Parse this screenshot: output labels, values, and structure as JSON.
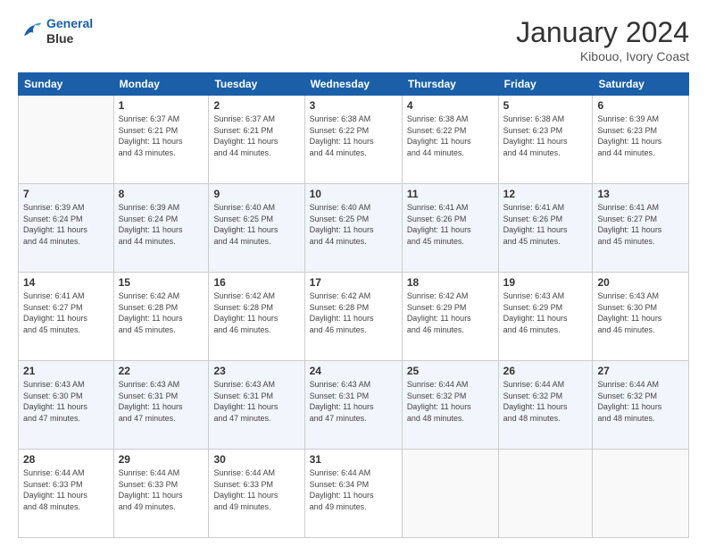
{
  "logo": {
    "line1": "General",
    "line2": "Blue"
  },
  "title": "January 2024",
  "location": "Kibouo, Ivory Coast",
  "days_header": [
    "Sunday",
    "Monday",
    "Tuesday",
    "Wednesday",
    "Thursday",
    "Friday",
    "Saturday"
  ],
  "weeks": [
    [
      {
        "day": "",
        "info": ""
      },
      {
        "day": "1",
        "info": "Sunrise: 6:37 AM\nSunset: 6:21 PM\nDaylight: 11 hours\nand 43 minutes."
      },
      {
        "day": "2",
        "info": "Sunrise: 6:37 AM\nSunset: 6:21 PM\nDaylight: 11 hours\nand 44 minutes."
      },
      {
        "day": "3",
        "info": "Sunrise: 6:38 AM\nSunset: 6:22 PM\nDaylight: 11 hours\nand 44 minutes."
      },
      {
        "day": "4",
        "info": "Sunrise: 6:38 AM\nSunset: 6:22 PM\nDaylight: 11 hours\nand 44 minutes."
      },
      {
        "day": "5",
        "info": "Sunrise: 6:38 AM\nSunset: 6:23 PM\nDaylight: 11 hours\nand 44 minutes."
      },
      {
        "day": "6",
        "info": "Sunrise: 6:39 AM\nSunset: 6:23 PM\nDaylight: 11 hours\nand 44 minutes."
      }
    ],
    [
      {
        "day": "7",
        "info": "Sunrise: 6:39 AM\nSunset: 6:24 PM\nDaylight: 11 hours\nand 44 minutes."
      },
      {
        "day": "8",
        "info": "Sunrise: 6:39 AM\nSunset: 6:24 PM\nDaylight: 11 hours\nand 44 minutes."
      },
      {
        "day": "9",
        "info": "Sunrise: 6:40 AM\nSunset: 6:25 PM\nDaylight: 11 hours\nand 44 minutes."
      },
      {
        "day": "10",
        "info": "Sunrise: 6:40 AM\nSunset: 6:25 PM\nDaylight: 11 hours\nand 44 minutes."
      },
      {
        "day": "11",
        "info": "Sunrise: 6:41 AM\nSunset: 6:26 PM\nDaylight: 11 hours\nand 45 minutes."
      },
      {
        "day": "12",
        "info": "Sunrise: 6:41 AM\nSunset: 6:26 PM\nDaylight: 11 hours\nand 45 minutes."
      },
      {
        "day": "13",
        "info": "Sunrise: 6:41 AM\nSunset: 6:27 PM\nDaylight: 11 hours\nand 45 minutes."
      }
    ],
    [
      {
        "day": "14",
        "info": "Sunrise: 6:41 AM\nSunset: 6:27 PM\nDaylight: 11 hours\nand 45 minutes."
      },
      {
        "day": "15",
        "info": "Sunrise: 6:42 AM\nSunset: 6:28 PM\nDaylight: 11 hours\nand 45 minutes."
      },
      {
        "day": "16",
        "info": "Sunrise: 6:42 AM\nSunset: 6:28 PM\nDaylight: 11 hours\nand 46 minutes."
      },
      {
        "day": "17",
        "info": "Sunrise: 6:42 AM\nSunset: 6:28 PM\nDaylight: 11 hours\nand 46 minutes."
      },
      {
        "day": "18",
        "info": "Sunrise: 6:42 AM\nSunset: 6:29 PM\nDaylight: 11 hours\nand 46 minutes."
      },
      {
        "day": "19",
        "info": "Sunrise: 6:43 AM\nSunset: 6:29 PM\nDaylight: 11 hours\nand 46 minutes."
      },
      {
        "day": "20",
        "info": "Sunrise: 6:43 AM\nSunset: 6:30 PM\nDaylight: 11 hours\nand 46 minutes."
      }
    ],
    [
      {
        "day": "21",
        "info": "Sunrise: 6:43 AM\nSunset: 6:30 PM\nDaylight: 11 hours\nand 47 minutes."
      },
      {
        "day": "22",
        "info": "Sunrise: 6:43 AM\nSunset: 6:31 PM\nDaylight: 11 hours\nand 47 minutes."
      },
      {
        "day": "23",
        "info": "Sunrise: 6:43 AM\nSunset: 6:31 PM\nDaylight: 11 hours\nand 47 minutes."
      },
      {
        "day": "24",
        "info": "Sunrise: 6:43 AM\nSunset: 6:31 PM\nDaylight: 11 hours\nand 47 minutes."
      },
      {
        "day": "25",
        "info": "Sunrise: 6:44 AM\nSunset: 6:32 PM\nDaylight: 11 hours\nand 48 minutes."
      },
      {
        "day": "26",
        "info": "Sunrise: 6:44 AM\nSunset: 6:32 PM\nDaylight: 11 hours\nand 48 minutes."
      },
      {
        "day": "27",
        "info": "Sunrise: 6:44 AM\nSunset: 6:32 PM\nDaylight: 11 hours\nand 48 minutes."
      }
    ],
    [
      {
        "day": "28",
        "info": "Sunrise: 6:44 AM\nSunset: 6:33 PM\nDaylight: 11 hours\nand 48 minutes."
      },
      {
        "day": "29",
        "info": "Sunrise: 6:44 AM\nSunset: 6:33 PM\nDaylight: 11 hours\nand 49 minutes."
      },
      {
        "day": "30",
        "info": "Sunrise: 6:44 AM\nSunset: 6:33 PM\nDaylight: 11 hours\nand 49 minutes."
      },
      {
        "day": "31",
        "info": "Sunrise: 6:44 AM\nSunset: 6:34 PM\nDaylight: 11 hours\nand 49 minutes."
      },
      {
        "day": "",
        "info": ""
      },
      {
        "day": "",
        "info": ""
      },
      {
        "day": "",
        "info": ""
      }
    ]
  ]
}
